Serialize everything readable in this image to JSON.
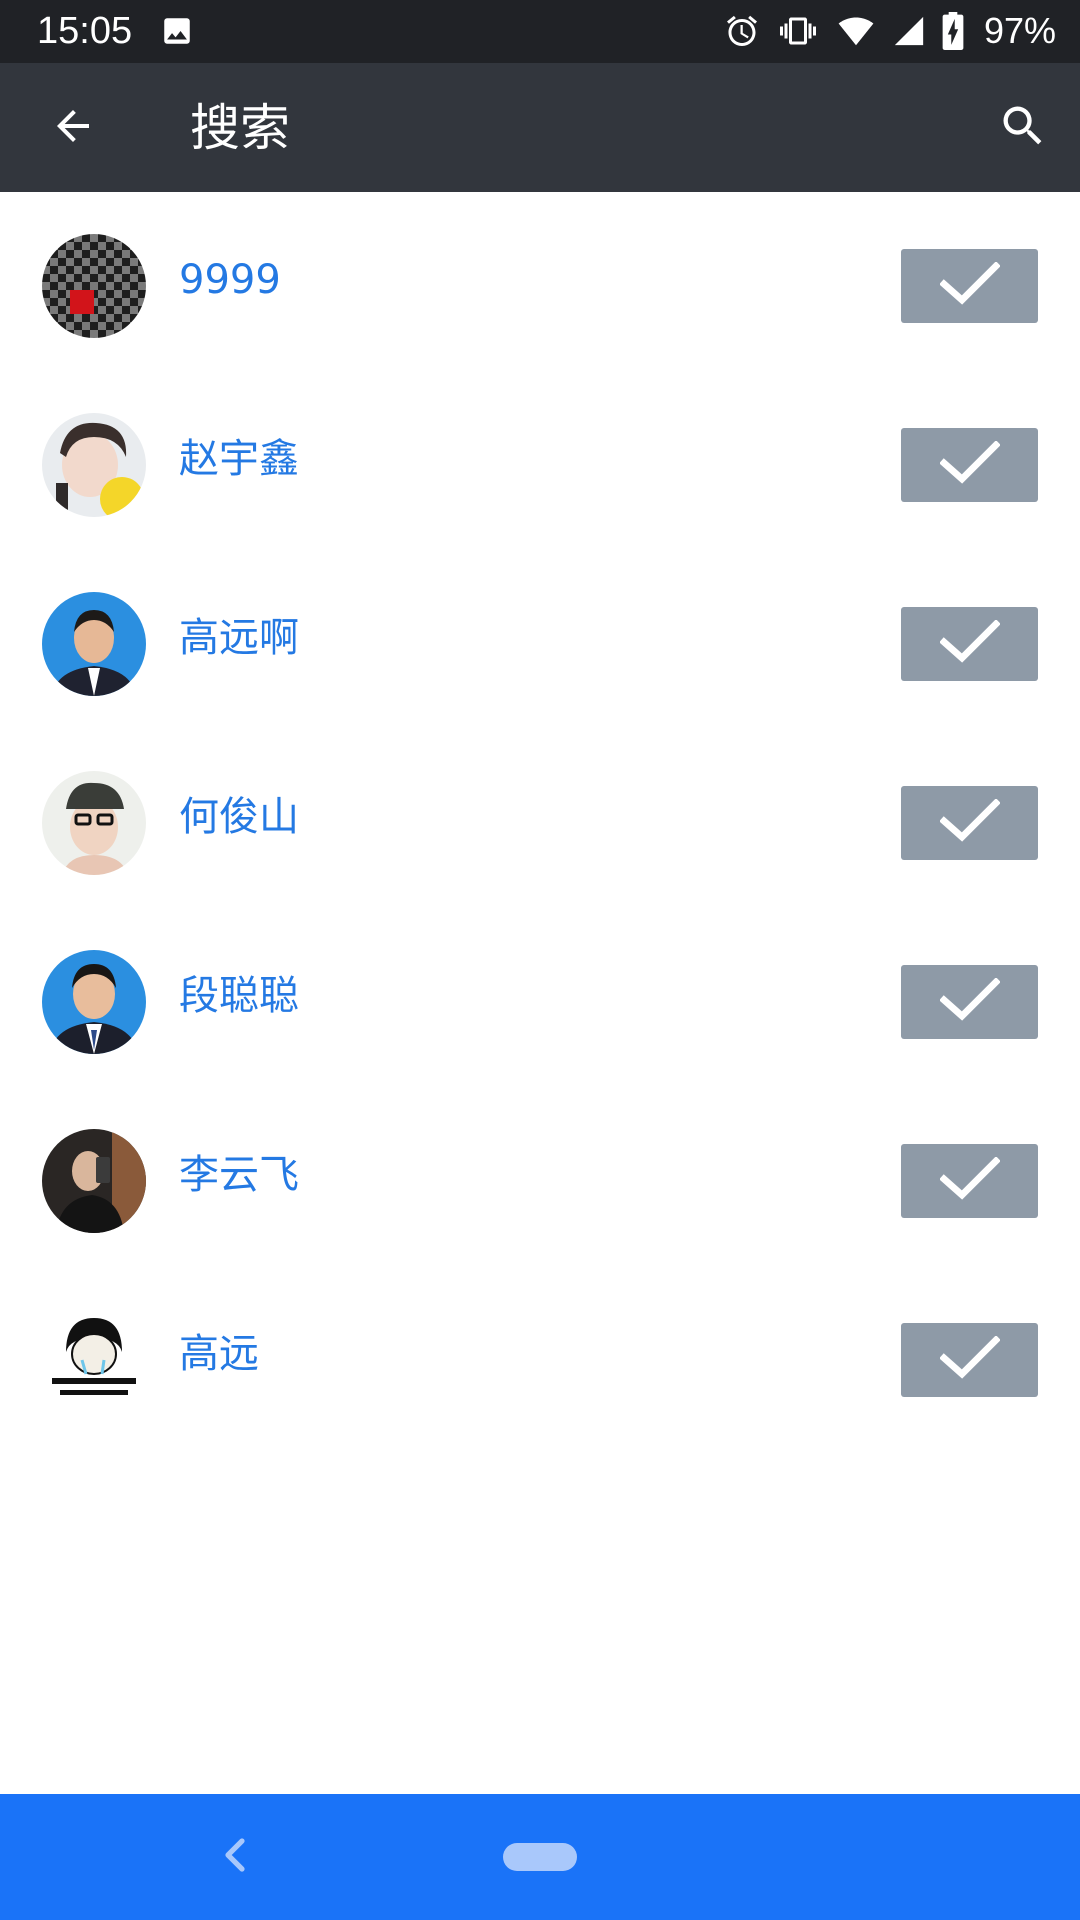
{
  "status_bar": {
    "time": "15:05",
    "battery": "97%",
    "icons": [
      "image-icon",
      "alarm-icon",
      "vibrate-icon",
      "wifi-icon",
      "signal-icon",
      "battery-icon"
    ]
  },
  "app_bar": {
    "title": "搜索",
    "icons": [
      "back-arrow-icon",
      "search-icon"
    ]
  },
  "contacts": [
    {
      "name": "9999",
      "avatar": "checker-avatar"
    },
    {
      "name": "赵宇鑫",
      "avatar": "photo-avatar"
    },
    {
      "name": "高远啊",
      "avatar": "photo-avatar"
    },
    {
      "name": "何俊山",
      "avatar": "photo-avatar"
    },
    {
      "name": "段聪聪",
      "avatar": "photo-avatar"
    },
    {
      "name": "李云飞",
      "avatar": "photo-avatar"
    },
    {
      "name": "高远",
      "avatar": "meme-avatar"
    }
  ],
  "colors": {
    "status_bar": "#202226",
    "app_bar": "#32363d",
    "name_text": "#2479e3",
    "check_button": "#8e9aa7",
    "nav_bar": "#1a73f8"
  }
}
